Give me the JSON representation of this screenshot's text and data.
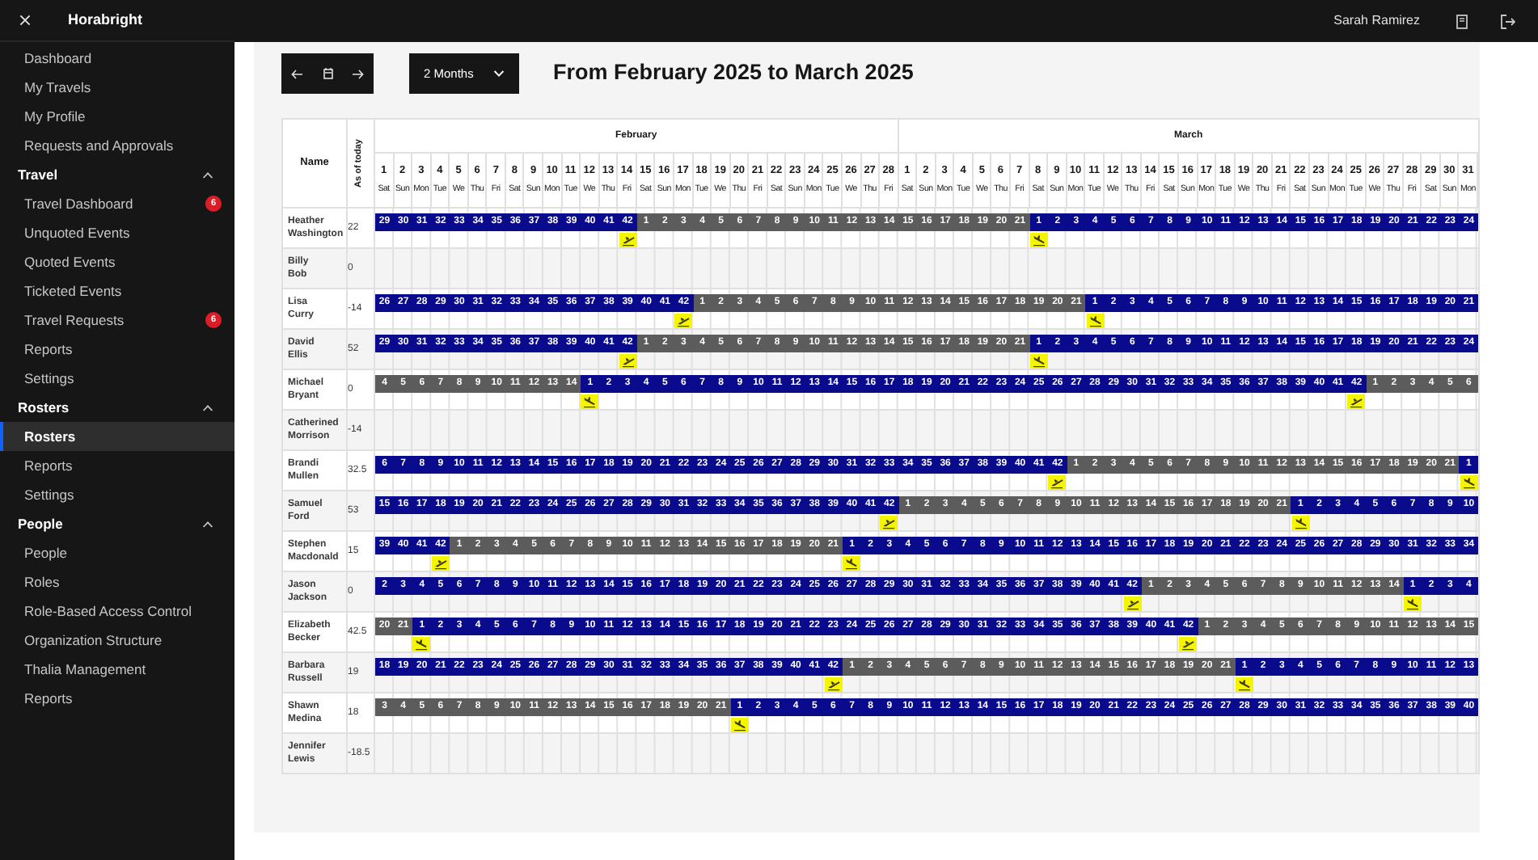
{
  "sidebar": {
    "title": "Horabright",
    "items": [
      {
        "label": "Dashboard",
        "selected": false
      },
      {
        "label": "My Travels",
        "selected": false
      },
      {
        "label": "My Profile",
        "selected": false
      },
      {
        "label": "Requests and Approvals",
        "selected": false
      }
    ],
    "sections": [
      {
        "title": "Travel",
        "expanded": true,
        "items": [
          {
            "label": "Travel Dashboard",
            "badge": "6",
            "selected": false
          },
          {
            "label": "Unquoted Events",
            "selected": false
          },
          {
            "label": "Quoted Events",
            "selected": false
          },
          {
            "label": "Ticketed Events",
            "selected": false
          },
          {
            "label": "Travel Requests",
            "badge": "6",
            "selected": false
          },
          {
            "label": "Reports",
            "selected": false
          },
          {
            "label": "Settings",
            "selected": false
          }
        ]
      },
      {
        "title": "Rosters",
        "expanded": true,
        "items": [
          {
            "label": "Rosters",
            "selected": true
          },
          {
            "label": "Reports",
            "selected": false
          },
          {
            "label": "Settings",
            "selected": false
          }
        ]
      },
      {
        "title": "People",
        "expanded": true,
        "items": [
          {
            "label": "People",
            "selected": false
          },
          {
            "label": "Roles",
            "selected": false
          },
          {
            "label": "Role-Based Access Control",
            "selected": false
          },
          {
            "label": "Organization Structure",
            "selected": false
          },
          {
            "label": "Thalia Management",
            "selected": false
          },
          {
            "label": "Reports",
            "selected": false
          }
        ]
      }
    ]
  },
  "topbar": {
    "user": "Sarah Ramirez"
  },
  "toolbar": {
    "range": "2 Months",
    "heading": "From February 2025 to March 2025"
  },
  "roster": {
    "name_header": "Name",
    "balance_header": "As of today",
    "months": [
      {
        "name": "February",
        "days": [
          {
            "d": "1",
            "w": "Sat"
          },
          {
            "d": "2",
            "w": "Sun"
          },
          {
            "d": "3",
            "w": "Mon"
          },
          {
            "d": "4",
            "w": "Tue"
          },
          {
            "d": "5",
            "w": "We"
          },
          {
            "d": "6",
            "w": "Thu"
          },
          {
            "d": "7",
            "w": "Fri"
          },
          {
            "d": "8",
            "w": "Sat"
          },
          {
            "d": "9",
            "w": "Sun"
          },
          {
            "d": "10",
            "w": "Mon"
          },
          {
            "d": "11",
            "w": "Tue"
          },
          {
            "d": "12",
            "w": "We"
          },
          {
            "d": "13",
            "w": "Thu"
          },
          {
            "d": "14",
            "w": "Fri"
          },
          {
            "d": "15",
            "w": "Sat"
          },
          {
            "d": "16",
            "w": "Sun"
          },
          {
            "d": "17",
            "w": "Mon"
          },
          {
            "d": "18",
            "w": "Tue"
          },
          {
            "d": "19",
            "w": "We"
          },
          {
            "d": "20",
            "w": "Thu"
          },
          {
            "d": "21",
            "w": "Fri"
          },
          {
            "d": "22",
            "w": "Sat"
          },
          {
            "d": "23",
            "w": "Sun"
          },
          {
            "d": "24",
            "w": "Mon"
          },
          {
            "d": "25",
            "w": "Tue"
          },
          {
            "d": "26",
            "w": "We"
          },
          {
            "d": "27",
            "w": "Thu"
          },
          {
            "d": "28",
            "w": "Fri"
          }
        ]
      },
      {
        "name": "March",
        "days": [
          {
            "d": "1",
            "w": "Sat"
          },
          {
            "d": "2",
            "w": "Sun"
          },
          {
            "d": "3",
            "w": "Mon"
          },
          {
            "d": "4",
            "w": "Tue"
          },
          {
            "d": "5",
            "w": "We"
          },
          {
            "d": "6",
            "w": "Thu"
          },
          {
            "d": "7",
            "w": "Fri"
          },
          {
            "d": "8",
            "w": "Sat"
          },
          {
            "d": "9",
            "w": "Sun"
          },
          {
            "d": "10",
            "w": "Mon"
          },
          {
            "d": "11",
            "w": "Tue"
          },
          {
            "d": "12",
            "w": "We"
          },
          {
            "d": "13",
            "w": "Thu"
          },
          {
            "d": "14",
            "w": "Fri"
          },
          {
            "d": "15",
            "w": "Sat"
          },
          {
            "d": "16",
            "w": "Sun"
          },
          {
            "d": "17",
            "w": "Mon"
          },
          {
            "d": "18",
            "w": "Tue"
          },
          {
            "d": "19",
            "w": "We"
          },
          {
            "d": "20",
            "w": "Thu"
          },
          {
            "d": "21",
            "w": "Fri"
          },
          {
            "d": "22",
            "w": "Sat"
          },
          {
            "d": "23",
            "w": "Sun"
          },
          {
            "d": "24",
            "w": "Mon"
          },
          {
            "d": "25",
            "w": "Tue"
          },
          {
            "d": "26",
            "w": "We"
          },
          {
            "d": "27",
            "w": "Thu"
          },
          {
            "d": "28",
            "w": "Fri"
          },
          {
            "d": "29",
            "w": "Sat"
          },
          {
            "d": "30",
            "w": "Sun"
          },
          {
            "d": "31",
            "w": "Mon"
          }
        ]
      }
    ],
    "rows": [
      {
        "name": "Heather Washington",
        "balance": "22",
        "segments": [
          {
            "kind": "on",
            "arrival": false,
            "departure": true,
            "cells": [
              "29",
              "30",
              "31",
              "32",
              "33",
              "34",
              "35",
              "36",
              "37",
              "38",
              "39",
              "40",
              "41",
              "42"
            ]
          },
          {
            "kind": "off",
            "arrival": false,
            "departure": false,
            "cells": [
              "1",
              "2",
              "3",
              "4",
              "5",
              "6",
              "7",
              "8",
              "9",
              "10",
              "11",
              "12",
              "13",
              "14",
              "15",
              "16",
              "17",
              "18",
              "19",
              "20",
              "21"
            ]
          },
          {
            "kind": "on",
            "arrival": true,
            "departure": false,
            "cells": [
              "1",
              "2",
              "3",
              "4",
              "5",
              "6",
              "7",
              "8",
              "9",
              "10",
              "11",
              "12",
              "13",
              "14",
              "15",
              "16",
              "17",
              "18",
              "19",
              "20",
              "21",
              "22",
              "23",
              "24"
            ]
          }
        ]
      },
      {
        "name": "Billy Bob",
        "balance": "0",
        "segments": []
      },
      {
        "name": "Lisa Curry",
        "balance": "-14",
        "segments": [
          {
            "kind": "on",
            "arrival": false,
            "departure": true,
            "cells": [
              "26",
              "27",
              "28",
              "29",
              "30",
              "31",
              "32",
              "33",
              "34",
              "35",
              "36",
              "37",
              "38",
              "39",
              "40",
              "41",
              "42"
            ]
          },
          {
            "kind": "off",
            "arrival": false,
            "departure": false,
            "cells": [
              "1",
              "2",
              "3",
              "4",
              "5",
              "6",
              "7",
              "8",
              "9",
              "10",
              "11",
              "12",
              "13",
              "14",
              "15",
              "16",
              "17",
              "18",
              "19",
              "20",
              "21"
            ]
          },
          {
            "kind": "on",
            "arrival": true,
            "departure": false,
            "cells": [
              "1",
              "2",
              "3",
              "4",
              "5",
              "6",
              "7",
              "8",
              "9",
              "10",
              "11",
              "12",
              "13",
              "14",
              "15",
              "16",
              "17",
              "18",
              "19",
              "20",
              "21"
            ]
          }
        ]
      },
      {
        "name": "David Ellis",
        "balance": "52",
        "segments": [
          {
            "kind": "on",
            "arrival": false,
            "departure": true,
            "cells": [
              "29",
              "30",
              "31",
              "32",
              "33",
              "34",
              "35",
              "36",
              "37",
              "38",
              "39",
              "40",
              "41",
              "42"
            ]
          },
          {
            "kind": "off",
            "arrival": false,
            "departure": false,
            "cells": [
              "1",
              "2",
              "3",
              "4",
              "5",
              "6",
              "7",
              "8",
              "9",
              "10",
              "11",
              "12",
              "13",
              "14",
              "15",
              "16",
              "17",
              "18",
              "19",
              "20",
              "21"
            ]
          },
          {
            "kind": "on",
            "arrival": true,
            "departure": false,
            "cells": [
              "1",
              "2",
              "3",
              "4",
              "5",
              "6",
              "7",
              "8",
              "9",
              "10",
              "11",
              "12",
              "13",
              "14",
              "15",
              "16",
              "17",
              "18",
              "19",
              "20",
              "21",
              "22",
              "23",
              "24"
            ]
          }
        ]
      },
      {
        "name": "Michael Bryant",
        "balance": "0",
        "segments": [
          {
            "kind": "off",
            "arrival": false,
            "departure": false,
            "cells": [
              "4",
              "5",
              "6",
              "7",
              "8",
              "9",
              "10",
              "11",
              "12",
              "13",
              "14"
            ]
          },
          {
            "kind": "on",
            "arrival": true,
            "departure": true,
            "cells": [
              "1",
              "2",
              "3",
              "4",
              "5",
              "6",
              "7",
              "8",
              "9",
              "10",
              "11",
              "12",
              "13",
              "14",
              "15",
              "16",
              "17",
              "18",
              "19",
              "20",
              "21",
              "22",
              "23",
              "24",
              "25",
              "26",
              "27",
              "28",
              "29",
              "30",
              "31",
              "32",
              "33",
              "34",
              "35",
              "36",
              "37",
              "38",
              "39",
              "40",
              "41",
              "42"
            ]
          },
          {
            "kind": "off",
            "arrival": false,
            "departure": false,
            "cells": [
              "1",
              "2",
              "3",
              "4",
              "5",
              "6"
            ]
          }
        ]
      },
      {
        "name": "Catherined Morrison",
        "balance": "-14",
        "segments": []
      },
      {
        "name": "Brandi Mullen",
        "balance": "32.5",
        "segments": [
          {
            "kind": "on",
            "arrival": false,
            "departure": true,
            "cells": [
              "6",
              "7",
              "8",
              "9",
              "10",
              "11",
              "12",
              "13",
              "14",
              "15",
              "16",
              "17",
              "18",
              "19",
              "20",
              "21",
              "22",
              "23",
              "24",
              "25",
              "26",
              "27",
              "28",
              "29",
              "30",
              "31",
              "32",
              "33",
              "34",
              "35",
              "36",
              "37",
              "38",
              "39",
              "40",
              "41",
              "42"
            ]
          },
          {
            "kind": "off",
            "arrival": false,
            "departure": false,
            "cells": [
              "1",
              "2",
              "3",
              "4",
              "5",
              "6",
              "7",
              "8",
              "9",
              "10",
              "11",
              "12",
              "13",
              "14",
              "15",
              "16",
              "17",
              "18",
              "19",
              "20",
              "21"
            ]
          },
          {
            "kind": "on",
            "arrival": true,
            "departure": false,
            "cells": [
              "1"
            ]
          }
        ]
      },
      {
        "name": "Samuel Ford",
        "balance": "53",
        "segments": [
          {
            "kind": "on",
            "arrival": false,
            "departure": true,
            "cells": [
              "15",
              "16",
              "17",
              "18",
              "19",
              "20",
              "21",
              "22",
              "23",
              "24",
              "25",
              "26",
              "27",
              "28",
              "29",
              "30",
              "31",
              "32",
              "33",
              "34",
              "35",
              "36",
              "37",
              "38",
              "39",
              "40",
              "41",
              "42"
            ]
          },
          {
            "kind": "off",
            "arrival": false,
            "departure": false,
            "cells": [
              "1",
              "2",
              "3",
              "4",
              "5",
              "6",
              "7",
              "8",
              "9",
              "10",
              "11",
              "12",
              "13",
              "14",
              "15",
              "16",
              "17",
              "18",
              "19",
              "20",
              "21"
            ]
          },
          {
            "kind": "on",
            "arrival": true,
            "departure": false,
            "cells": [
              "1",
              "2",
              "3",
              "4",
              "5",
              "6",
              "7",
              "8",
              "9",
              "10"
            ]
          }
        ]
      },
      {
        "name": "Stephen Macdonald",
        "balance": "15",
        "segments": [
          {
            "kind": "on",
            "arrival": false,
            "departure": true,
            "cells": [
              "39",
              "40",
              "41",
              "42"
            ]
          },
          {
            "kind": "off",
            "arrival": false,
            "departure": false,
            "cells": [
              "1",
              "2",
              "3",
              "4",
              "5",
              "6",
              "7",
              "8",
              "9",
              "10",
              "11",
              "12",
              "13",
              "14",
              "15",
              "16",
              "17",
              "18",
              "19",
              "20",
              "21"
            ]
          },
          {
            "kind": "on",
            "arrival": true,
            "departure": false,
            "cells": [
              "1",
              "2",
              "3",
              "4",
              "5",
              "6",
              "7",
              "8",
              "9",
              "10",
              "11",
              "12",
              "13",
              "14",
              "15",
              "16",
              "17",
              "18",
              "19",
              "20",
              "21",
              "22",
              "23",
              "24",
              "25",
              "26",
              "27",
              "28",
              "29",
              "30",
              "31",
              "32",
              "33",
              "34"
            ]
          }
        ]
      },
      {
        "name": "Jason Jackson",
        "balance": "0",
        "segments": [
          {
            "kind": "on",
            "arrival": false,
            "departure": true,
            "cells": [
              "2",
              "3",
              "4",
              "5",
              "6",
              "7",
              "8",
              "9",
              "10",
              "11",
              "12",
              "13",
              "14",
              "15",
              "16",
              "17",
              "18",
              "19",
              "20",
              "21",
              "22",
              "23",
              "24",
              "25",
              "26",
              "27",
              "28",
              "29",
              "30",
              "31",
              "32",
              "33",
              "34",
              "35",
              "36",
              "37",
              "38",
              "39",
              "40",
              "41",
              "42"
            ]
          },
          {
            "kind": "off",
            "arrival": false,
            "departure": false,
            "cells": [
              "1",
              "2",
              "3",
              "4",
              "5",
              "6",
              "7",
              "8",
              "9",
              "10",
              "11",
              "12",
              "13",
              "14"
            ]
          },
          {
            "kind": "on",
            "arrival": true,
            "departure": false,
            "cells": [
              "1",
              "2",
              "3",
              "4"
            ]
          }
        ]
      },
      {
        "name": "Elizabeth Becker",
        "balance": "42.5",
        "segments": [
          {
            "kind": "off",
            "arrival": false,
            "departure": false,
            "cells": [
              "20",
              "21"
            ]
          },
          {
            "kind": "on",
            "arrival": true,
            "departure": true,
            "cells": [
              "1",
              "2",
              "3",
              "4",
              "5",
              "6",
              "7",
              "8",
              "9",
              "10",
              "11",
              "12",
              "13",
              "14",
              "15",
              "16",
              "17",
              "18",
              "19",
              "20",
              "21",
              "22",
              "23",
              "24",
              "25",
              "26",
              "27",
              "28",
              "29",
              "30",
              "31",
              "32",
              "33",
              "34",
              "35",
              "36",
              "37",
              "38",
              "39",
              "40",
              "41",
              "42"
            ]
          },
          {
            "kind": "off",
            "arrival": false,
            "departure": false,
            "cells": [
              "1",
              "2",
              "3",
              "4",
              "5",
              "6",
              "7",
              "8",
              "9",
              "10",
              "11",
              "12",
              "13",
              "14",
              "15"
            ]
          }
        ]
      },
      {
        "name": "Barbara Russell",
        "balance": "19",
        "segments": [
          {
            "kind": "on",
            "arrival": false,
            "departure": true,
            "cells": [
              "18",
              "19",
              "20",
              "21",
              "22",
              "23",
              "24",
              "25",
              "26",
              "27",
              "28",
              "29",
              "30",
              "31",
              "32",
              "33",
              "34",
              "35",
              "36",
              "37",
              "38",
              "39",
              "40",
              "41",
              "42"
            ]
          },
          {
            "kind": "off",
            "arrival": false,
            "departure": false,
            "cells": [
              "1",
              "2",
              "3",
              "4",
              "5",
              "6",
              "7",
              "8",
              "9",
              "10",
              "11",
              "12",
              "13",
              "14",
              "15",
              "16",
              "17",
              "18",
              "19",
              "20",
              "21"
            ]
          },
          {
            "kind": "on",
            "arrival": true,
            "departure": false,
            "cells": [
              "1",
              "2",
              "3",
              "4",
              "5",
              "6",
              "7",
              "8",
              "9",
              "10",
              "11",
              "12",
              "13"
            ]
          }
        ]
      },
      {
        "name": "Shawn Medina",
        "balance": "18",
        "segments": [
          {
            "kind": "off",
            "arrival": false,
            "departure": false,
            "cells": [
              "3",
              "4",
              "5",
              "6",
              "7",
              "8",
              "9",
              "10",
              "11",
              "12",
              "13",
              "14",
              "15",
              "16",
              "17",
              "18",
              "19",
              "20",
              "21"
            ]
          },
          {
            "kind": "on",
            "arrival": true,
            "departure": false,
            "cells": [
              "1",
              "2",
              "3",
              "4",
              "5",
              "6",
              "7",
              "8",
              "9",
              "10",
              "11",
              "12",
              "13",
              "14",
              "15",
              "16",
              "17",
              "18",
              "19",
              "20",
              "21",
              "22",
              "23",
              "24",
              "25",
              "26",
              "27",
              "28",
              "29",
              "30",
              "31",
              "32",
              "33",
              "34",
              "35",
              "36",
              "37",
              "38",
              "39",
              "40"
            ]
          }
        ]
      },
      {
        "name": "Jennifer Lewis",
        "balance": "-18.5",
        "segments": []
      }
    ]
  }
}
